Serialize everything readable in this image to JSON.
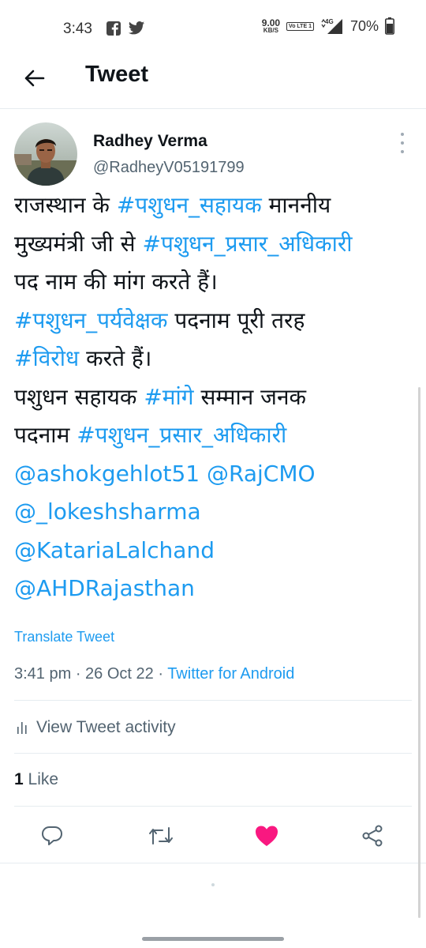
{
  "status_bar": {
    "time": "3:43",
    "speed_value": "9.00",
    "speed_unit": "KB/S",
    "volte_label": "Vo LTE 1",
    "network": "4G",
    "battery": "70%"
  },
  "header": {
    "title": "Tweet"
  },
  "tweet": {
    "author_name": "Radhey Verma",
    "author_handle": "@RadheyV05191799",
    "lines": [
      [
        {
          "t": "राजस्थान के "
        },
        {
          "t": "#पशुधन_सहायक",
          "link": true
        },
        {
          "t": " माननीय"
        }
      ],
      [
        {
          "t": "मुख्यमंत्री जी से "
        },
        {
          "t": "#पशुधन_प्रसार_अधिकारी",
          "link": true
        }
      ],
      [
        {
          "t": "पद नाम की मांग करते हैं।"
        }
      ],
      [
        {
          "t": "#पशुधन_पर्यवेक्षक",
          "link": true
        },
        {
          "t": " पदनाम पूरी तरह"
        }
      ],
      [
        {
          "t": "#विरोध",
          "link": true
        },
        {
          "t": " करते हैं।"
        }
      ],
      [
        {
          "t": "पशुधन सहायक "
        },
        {
          "t": "#मांगे",
          "link": true
        },
        {
          "t": " सम्मान जनक"
        }
      ],
      [
        {
          "t": "पदनाम "
        },
        {
          "t": "#पशुधन_प्रसार_अधिकारी",
          "link": true
        }
      ],
      [
        {
          "t": "@ashokgehlot51",
          "link": true
        },
        {
          "t": " "
        },
        {
          "t": "@RajCMO",
          "link": true
        }
      ],
      [
        {
          "t": "@_lokeshsharma",
          "link": true
        }
      ],
      [
        {
          "t": "@KatariaLalchand",
          "link": true
        }
      ],
      [
        {
          "t": "@AHDRajasthan",
          "link": true
        }
      ]
    ],
    "translate_label": "Translate Tweet",
    "time": "3:41 pm",
    "separator": " · ",
    "date": "26 Oct 22",
    "source": "Twitter for Android",
    "activity_label": "View Tweet activity",
    "like_count": "1",
    "like_label": " Like"
  },
  "colors": {
    "link": "#1d9bf0",
    "like": "#f91880",
    "icon": "#536471"
  },
  "icons": {
    "back": "arrow-left-icon",
    "more": "vertical-dots-icon",
    "activity": "bar-chart-icon",
    "reply": "speech-bubble-icon",
    "retweet": "retweet-icon",
    "like": "heart-icon",
    "share": "share-icon"
  }
}
